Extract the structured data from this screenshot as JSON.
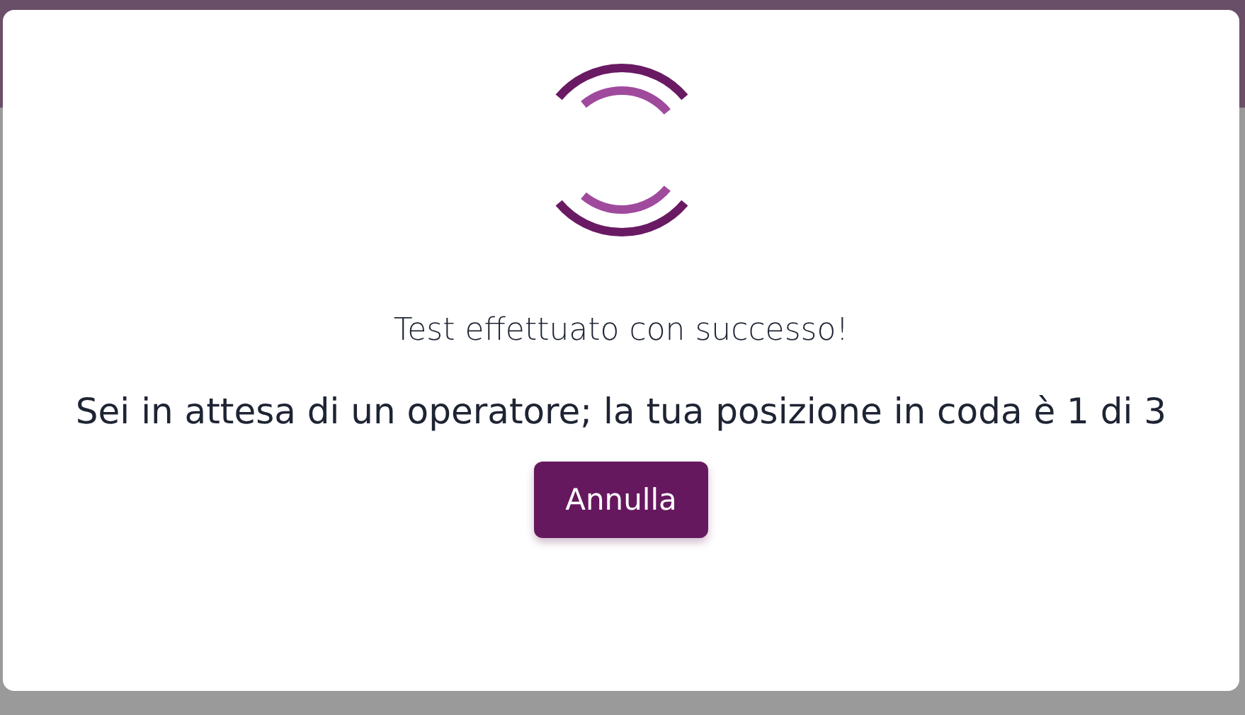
{
  "dialog": {
    "status": "Test effettuato con successo!",
    "message": "Sei in attesa di un operatore; la tua posizione in coda è 1 di 3",
    "buttons": [
      {
        "label": "Annulla"
      }
    ]
  }
}
